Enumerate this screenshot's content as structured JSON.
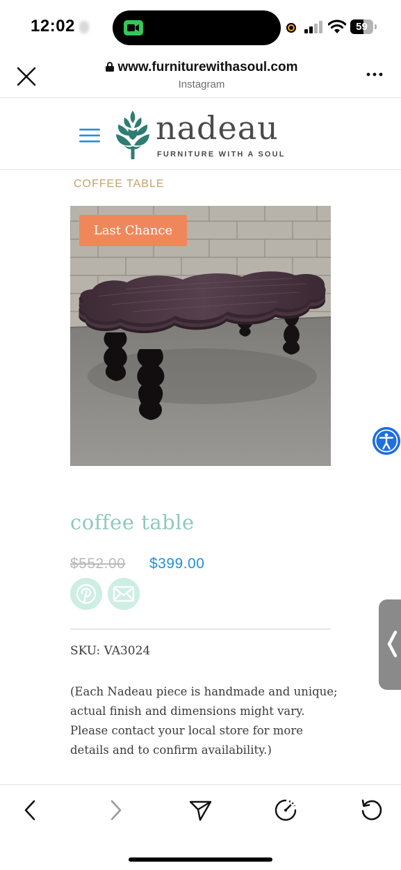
{
  "status_bar": {
    "time": "12:02",
    "battery_level": "59",
    "battery_fraction": 0.59,
    "icons": [
      "facetime-video-icon",
      "mic-in-use-indicator",
      "cellular-signal-icon",
      "wifi-icon",
      "battery-icon"
    ]
  },
  "browser": {
    "url": "www.furniturewithasoul.com",
    "source": "Instagram",
    "icons": [
      "close-icon",
      "lock-icon",
      "more-icon"
    ]
  },
  "site": {
    "logo_word": "nadeau",
    "logo_tagline": "FURNITURE WITH A SOUL",
    "brand_colors": {
      "teal": "#2f7c74",
      "charcoal": "#4a4a4a"
    },
    "icons": [
      "menu-icon",
      "artichoke-logo-icon"
    ]
  },
  "product": {
    "breadcrumb": "COFFEE TABLE",
    "badge": "Last Chance",
    "title": "coffee table",
    "price_old": "$552.00",
    "price_new": "$399.00",
    "sku": "SKU: VA3024",
    "note": "(Each Nadeau piece is handmade and unique; actual finish and dimensions might vary. Please contact your local store for more details and to confirm availability.)",
    "colors": {
      "badge": "#f0875a",
      "title": "#8ec9bb",
      "price": "#1f8fd8",
      "breadcrumb": "#c4a26a"
    },
    "share_icons": [
      "pinterest-icon",
      "email-icon"
    ]
  },
  "toolbar": {
    "icons": [
      "back-icon",
      "forward-icon",
      "share-send-icon",
      "speed-icon",
      "reload-icon"
    ]
  }
}
